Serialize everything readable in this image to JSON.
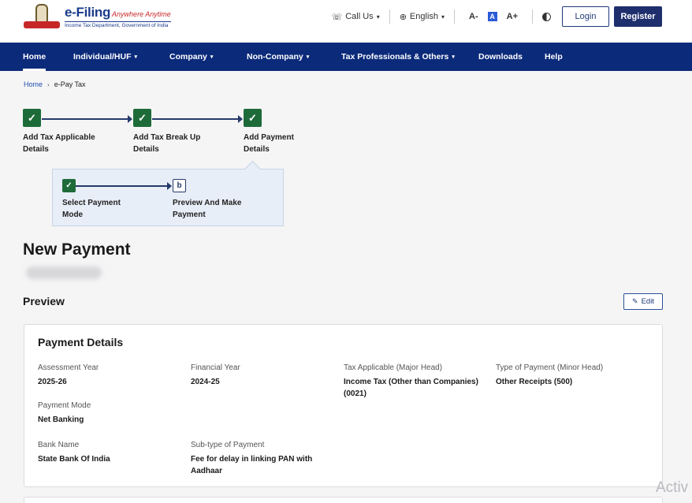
{
  "header": {
    "brand": "e-Filing",
    "tagline": "Anywhere Anytime",
    "department": "Income Tax Department, Government of India",
    "call_us": "Call Us",
    "language": "English",
    "font_decrease": "A-",
    "font_normal": "A",
    "font_increase": "A+",
    "login": "Login",
    "register": "Register"
  },
  "nav": {
    "items": [
      {
        "label": "Home"
      },
      {
        "label": "Individual/HUF"
      },
      {
        "label": "Company"
      },
      {
        "label": "Non-Company"
      },
      {
        "label": "Tax Professionals & Others"
      },
      {
        "label": "Downloads"
      },
      {
        "label": "Help"
      }
    ]
  },
  "breadcrumb": {
    "home": "Home",
    "current": "e-Pay Tax"
  },
  "stepper": {
    "steps": [
      {
        "label": "Add Tax Applicable Details"
      },
      {
        "label": "Add Tax Break Up Details"
      },
      {
        "label": "Add Payment Details"
      }
    ],
    "substeps": [
      {
        "label": "Select Payment Mode"
      },
      {
        "label": "Preview And Make Payment",
        "marker": "b"
      }
    ]
  },
  "page": {
    "title": "New Payment",
    "preview_title": "Preview",
    "edit_label": "Edit"
  },
  "payment_details": {
    "title": "Payment Details",
    "fields": [
      {
        "label": "Assessment Year",
        "value": "2025-26"
      },
      {
        "label": "Financial Year",
        "value": "2024-25"
      },
      {
        "label": "Tax Applicable (Major Head)",
        "value": "Income Tax (Other than Companies) (0021)"
      },
      {
        "label": "Type of Payment (Minor Head)",
        "value": "Other Receipts (500)"
      },
      {
        "label": "Payment Mode",
        "value": "Net Banking"
      },
      {
        "label": "Bank Name",
        "value": "State Bank Of India"
      },
      {
        "label": "Sub-type of Payment",
        "value": "Fee for delay in linking PAN with Aadhaar"
      }
    ]
  },
  "watermark": "Activ",
  "colors": {
    "nav_bg": "#0b2a7a",
    "step_done": "#1e6b3a",
    "register_bg": "#1f2f6e",
    "link": "#1f4fae"
  }
}
